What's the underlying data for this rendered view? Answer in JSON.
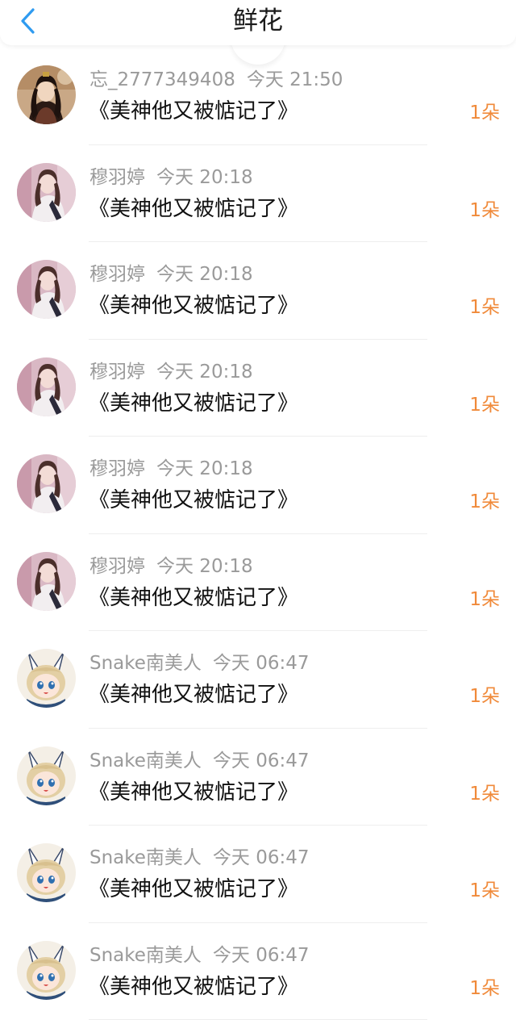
{
  "header": {
    "title": "鲜花",
    "back_icon": "chevron-left-icon",
    "accent_color": "#2f9bf0"
  },
  "colors": {
    "count_text": "#f08a3a",
    "meta_text": "#9a9a9a",
    "title_text": "#1a1a1a"
  },
  "items": [
    {
      "name": "忘_2777349408",
      "time": "今天 21:50",
      "book": "《美神他又被惦记了》",
      "count": "1朵",
      "avatar": "avatar-ancient-costume"
    },
    {
      "name": "穆羽婷",
      "time": "今天 20:18",
      "book": "《美神他又被惦记了》",
      "count": "1朵",
      "avatar": "avatar-pink-girl"
    },
    {
      "name": "穆羽婷",
      "time": "今天 20:18",
      "book": "《美神他又被惦记了》",
      "count": "1朵",
      "avatar": "avatar-pink-girl"
    },
    {
      "name": "穆羽婷",
      "time": "今天 20:18",
      "book": "《美神他又被惦记了》",
      "count": "1朵",
      "avatar": "avatar-pink-girl"
    },
    {
      "name": "穆羽婷",
      "time": "今天 20:18",
      "book": "《美神他又被惦记了》",
      "count": "1朵",
      "avatar": "avatar-pink-girl"
    },
    {
      "name": "穆羽婷",
      "time": "今天 20:18",
      "book": "《美神他又被惦记了》",
      "count": "1朵",
      "avatar": "avatar-pink-girl"
    },
    {
      "name": "Snake南美人",
      "time": "今天 06:47",
      "book": "《美神他又被惦记了》",
      "count": "1朵",
      "avatar": "avatar-chibi-bunny"
    },
    {
      "name": "Snake南美人",
      "time": "今天 06:47",
      "book": "《美神他又被惦记了》",
      "count": "1朵",
      "avatar": "avatar-chibi-bunny"
    },
    {
      "name": "Snake南美人",
      "time": "今天 06:47",
      "book": "《美神他又被惦记了》",
      "count": "1朵",
      "avatar": "avatar-chibi-bunny"
    },
    {
      "name": "Snake南美人",
      "time": "今天 06:47",
      "book": "《美神他又被惦记了》",
      "count": "1朵",
      "avatar": "avatar-chibi-bunny"
    }
  ]
}
